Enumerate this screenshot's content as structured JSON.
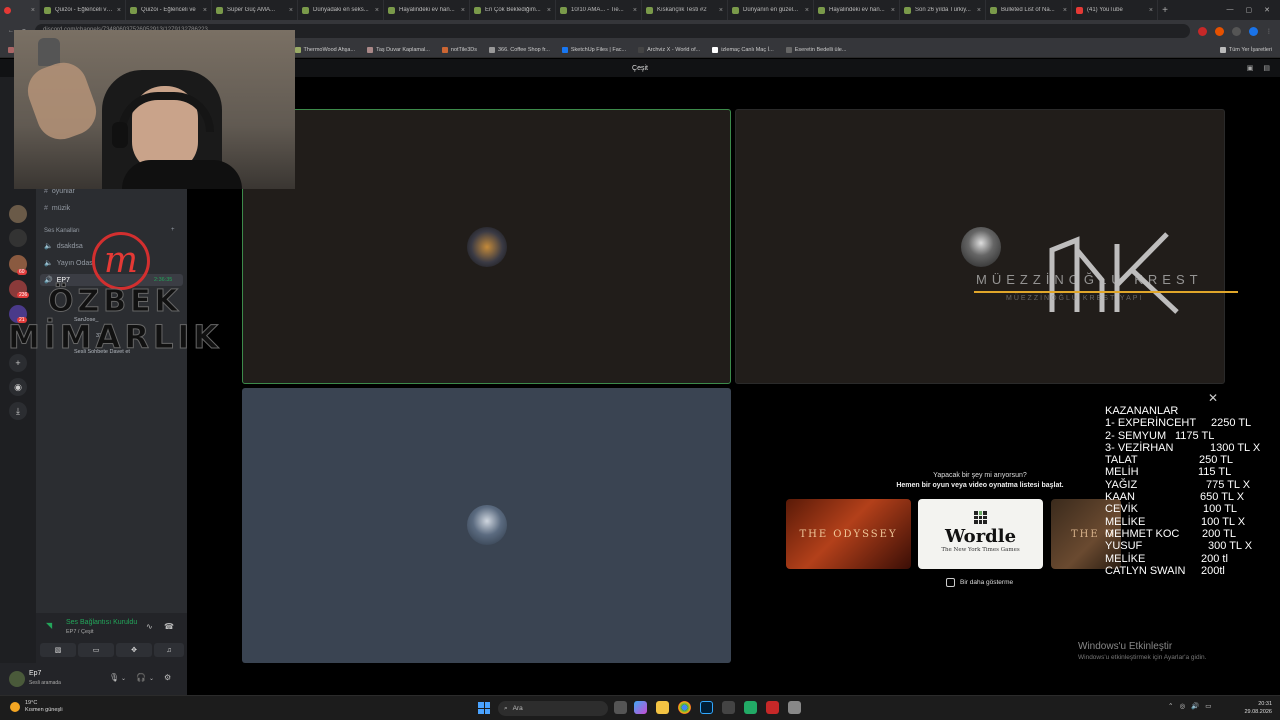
{
  "browser": {
    "tabs": [
      {
        "label": "",
        "icon": "chrome-icon"
      },
      {
        "label": "Quizoi - Eğlenceli ve...",
        "icon": "quiz-icon"
      },
      {
        "label": "Quizoi - Eğlenceli ve",
        "icon": "quiz-icon"
      },
      {
        "label": "Süper Güç AMA...",
        "icon": "quiz-icon"
      },
      {
        "label": "Dünyadaki en seks...",
        "icon": "quiz-icon"
      },
      {
        "label": "Hayalindeki ev han...",
        "icon": "quiz-icon"
      },
      {
        "label": "En Çok Beklediğim...",
        "icon": "quiz-icon"
      },
      {
        "label": "10/10 AMA... - Tie...",
        "icon": "quiz-icon"
      },
      {
        "label": "Kıskançlık Testi #2",
        "icon": "quiz-icon"
      },
      {
        "label": "Dünyanın en güzel...",
        "icon": "quiz-icon"
      },
      {
        "label": "Hayalindeki ev han...",
        "icon": "quiz-icon"
      },
      {
        "label": "Son 26 yılda Türkiy...",
        "icon": "quiz-icon"
      },
      {
        "label": "Bulleted List of Na...",
        "icon": "quiz-icon"
      },
      {
        "label": "(41) YouTube",
        "icon": "youtube-icon"
      }
    ],
    "new_tab_symbol": "+",
    "window_controls": [
      "—",
      "▢",
      "✕"
    ],
    "url": "discord.com/channels/734806037526052913/1279132786223",
    "bookmarks": [
      "dern Tuğla, 68 S...",
      "Quixel Megascans",
      "3D TEXTURES | Free...",
      "Search Results on a...",
      "ThermoWood Ahşa...",
      "Taş Duvar Kaplamal...",
      "notTile3Ds",
      "366. Coffee Shop fr...",
      "SketchUp Files | Fac...",
      "Archviz X - World of...",
      "izlemaç Canlı Maç İ...",
      "Eseretin Bedelli üle..."
    ],
    "bookmarks_all": "Tüm Yer İşaretleri"
  },
  "discord": {
    "title": "Çeşit",
    "server_badges": [
      "60",
      "236",
      "21"
    ],
    "channels": {
      "text": [
        "oyunlar",
        "müzik"
      ],
      "voice_category": "Ses Kanalları",
      "voice": [
        "dsakdsa",
        "Yayın Odası"
      ],
      "active_voice": "EP7",
      "active_voice_time": "2:36:35",
      "members": [
        "SanJose_",
        "32"
      ],
      "invite": "Sesli Sohbete Davet et"
    },
    "voice_panel": {
      "status": "Ses Bağlantısı Kuruldu",
      "sub": "EP7 / Çeşit"
    },
    "user": {
      "name": "Ep7",
      "status": "Sesli aramada"
    }
  },
  "brand": {
    "logo_letter": "m",
    "line1": "ÖZBEK",
    "line2": "MİMARLIK"
  },
  "stage": {
    "mk_text": "MÜEZZİNOĞLU KREST",
    "mk_sub": "MÜEZZİNOĞLU KREST YAPI"
  },
  "activity": {
    "prompt1": "Yapacak bir şey mi arıyorsun?",
    "prompt2": "Hemen bir oyun veya video oynatma listesi başlat.",
    "cards": {
      "odyssey": "THE ODYSSEY",
      "wordle": "Wordle",
      "wordle_sub": "The New York Times Games",
      "third": "THE O"
    },
    "dont_show": "Bir daha gösterme"
  },
  "winners": {
    "title": "KAZANANLAR",
    "rows": [
      {
        "name": "1- EXPERİNCEHT",
        "amount": "2250 TL"
      },
      {
        "name": "2- SEMYUM",
        "amount": "1175 TL"
      },
      {
        "name": "3- VEZİRHAN",
        "amount": "1300  TL X"
      },
      {
        "name": "TALAT",
        "amount": "250 TL"
      },
      {
        "name": "MELİH",
        "amount": "115 TL"
      },
      {
        "name": "YAĞIZ",
        "amount": "775 TL  X"
      },
      {
        "name": "KAAN",
        "amount": "650 TL  X"
      },
      {
        "name": "CEVİK",
        "amount": "100 TL"
      },
      {
        "name": "MELİKE",
        "amount": "100 TL X"
      },
      {
        "name": "MEHMET KOC",
        "amount": "200 TL"
      },
      {
        "name": "YUSUF",
        "amount": "300 TL X"
      },
      {
        "name": "MELİKE",
        "amount": "200 tl"
      },
      {
        "name": "CATLYN SWAIN",
        "amount": "200tl"
      }
    ]
  },
  "windows": {
    "activate_title": "Windows'u Etkinleştir",
    "activate_sub": "Windows'u etkinleştirmek için Ayarlar'a gidin.",
    "weather_temp": "19°C",
    "weather_desc": "Kısmen güneşli",
    "search_placeholder": "Ara",
    "time": "20:31",
    "date": "29.08.2026"
  },
  "colors": {
    "discord_green": "#23a55a",
    "speaking_border": "#3c8a4a",
    "logo_red": "#e53935",
    "mk_gold": "#e0a62a"
  }
}
